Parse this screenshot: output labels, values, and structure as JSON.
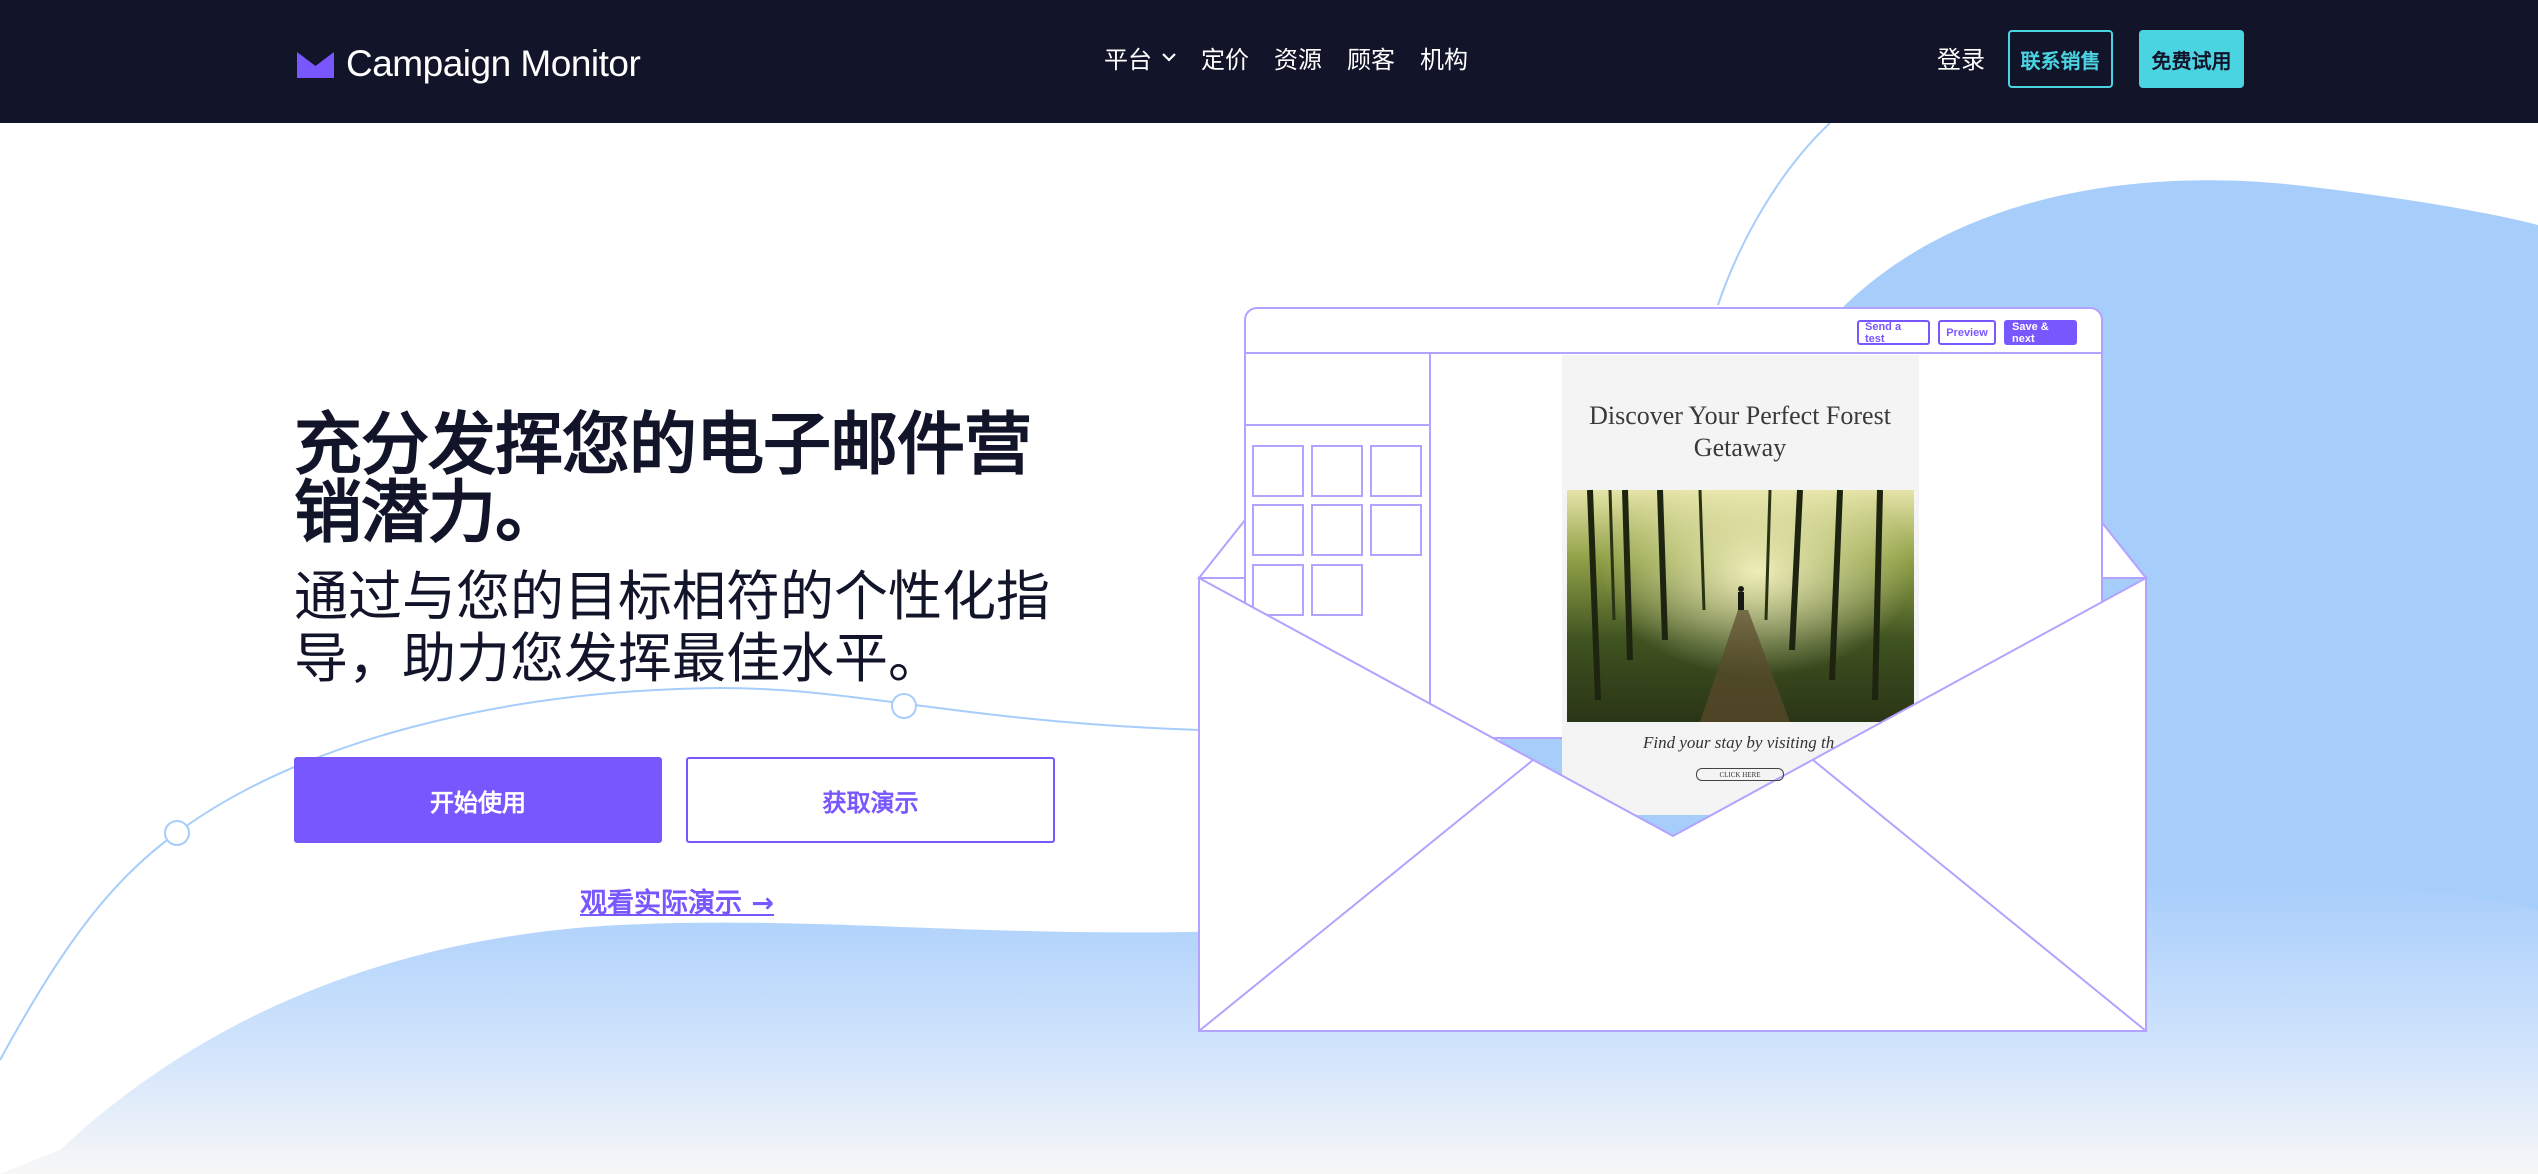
{
  "nav": {
    "brand": "Campaign Monitor",
    "menu": [
      {
        "label": "平台"
      },
      {
        "label": "定价"
      },
      {
        "label": "资源"
      },
      {
        "label": "顾客"
      },
      {
        "label": "机构"
      }
    ],
    "login": "登录",
    "contact_sales": "联系销售",
    "free_trial": "免费试用"
  },
  "hero": {
    "headline": "充分发挥您的电子邮件营销潜力。",
    "subhead": "通过与您的目标相符的个性化指导，助力您发挥最佳水平。",
    "start_button": "开始使用",
    "demo_button": "获取演示",
    "live_demo_link": "观看实际演示 →"
  },
  "editor_mockup": {
    "buttons": {
      "send_test": "Send a test",
      "preview": "Preview",
      "save_next": "Save & next"
    },
    "email": {
      "title": "Discover Your Perfect Forest Getaway",
      "caption": "Find your stay by visiting th",
      "cta": "CLICK HERE"
    }
  },
  "colors": {
    "nav_bg": "#12142a",
    "accent": "#7857ff",
    "cyan": "#4ad4e2",
    "wave_blue": "#a7cdfb"
  }
}
